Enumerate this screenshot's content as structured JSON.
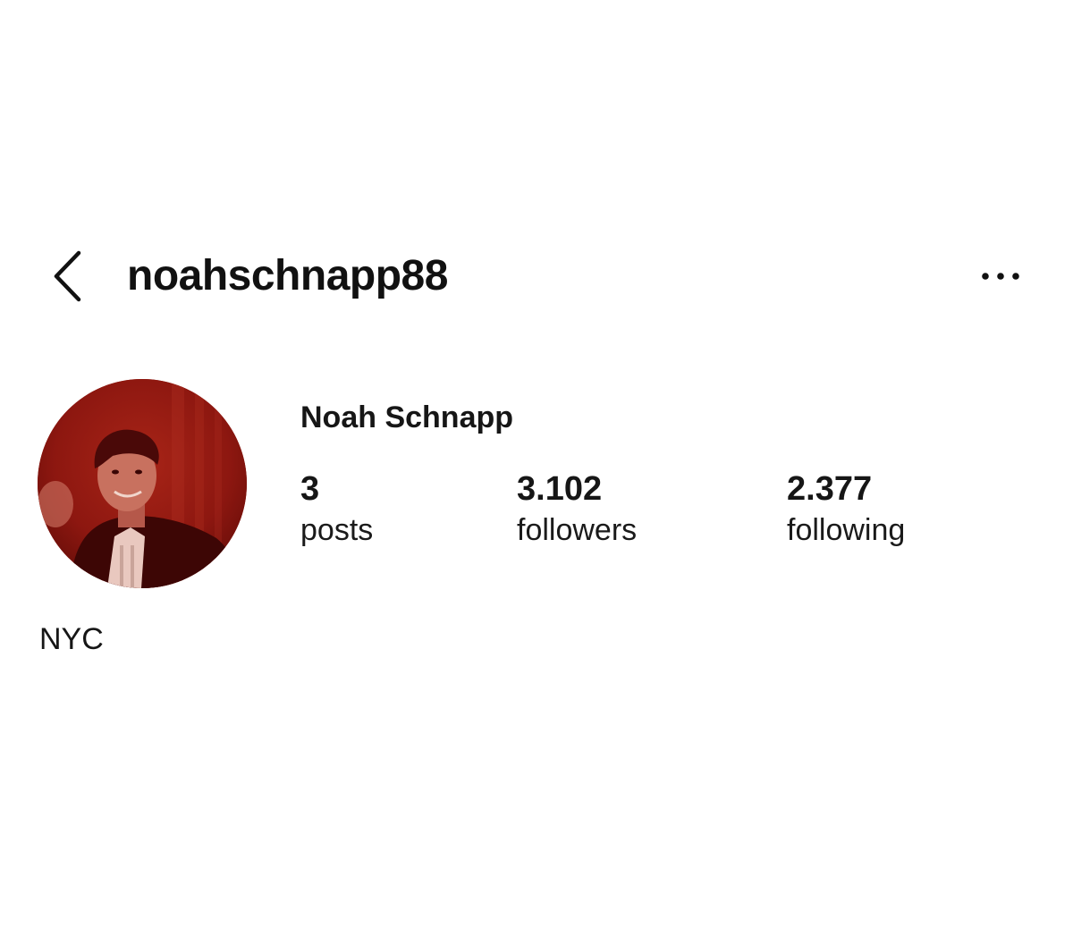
{
  "header": {
    "back_icon": "chevron-left-icon",
    "username": "noahschnapp88",
    "more_icon": "more-horizontal-icon"
  },
  "profile": {
    "avatar_tint": "#8e1710",
    "display_name": "Noah Schnapp",
    "stats": [
      {
        "count": "3",
        "label": "posts"
      },
      {
        "count": "3.102",
        "label": "followers"
      },
      {
        "count": "2.377",
        "label": "following"
      }
    ],
    "bio": "NYC"
  }
}
